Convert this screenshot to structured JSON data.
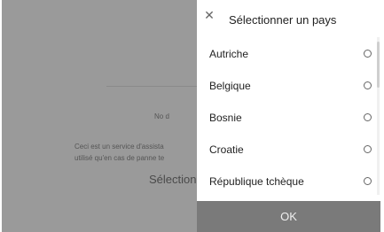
{
  "background": {
    "no_text": "No d",
    "info_line1": "Ceci est un service d'assista",
    "info_line2": "utilisé qu'en cas de panne te",
    "select_label": "Sélectionn"
  },
  "panel": {
    "title": "Sélectionner un pays",
    "close_icon": "close-icon",
    "countries": [
      {
        "label": "Autriche",
        "selected": false
      },
      {
        "label": "Belgique",
        "selected": false
      },
      {
        "label": "Bosnie",
        "selected": false
      },
      {
        "label": "Croatie",
        "selected": false
      },
      {
        "label": "République tchèque",
        "selected": false
      }
    ],
    "ok_label": "OK"
  },
  "colors": {
    "overlay": "#9a9a9a",
    "ok_button": "#7a7a7a"
  }
}
